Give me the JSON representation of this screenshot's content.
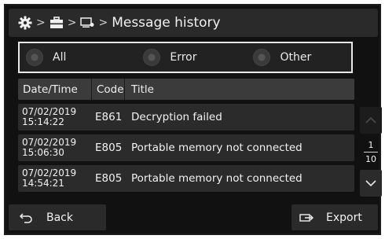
{
  "header": {
    "breadcrumb": [
      {
        "icon": "gear-icon"
      },
      {
        "icon": "toolbox-icon"
      },
      {
        "icon": "device-icon"
      }
    ],
    "title": "Message history"
  },
  "filters": {
    "options": [
      "All",
      "Error",
      "Other"
    ]
  },
  "table": {
    "columns": [
      "Date/Time",
      "Code",
      "Title"
    ],
    "rows": [
      {
        "date": "07/02/2019",
        "time": "15:14:22",
        "code": "E861",
        "title": "Decryption failed"
      },
      {
        "date": "07/02/2019",
        "time": "15:06:30",
        "code": "E805",
        "title": "Portable memory not connected"
      },
      {
        "date": "07/02/2019",
        "time": "14:54:21",
        "code": "E805",
        "title": "Portable memory not connected"
      }
    ]
  },
  "pager": {
    "current": "1",
    "total": "10"
  },
  "footer": {
    "back_label": "Back",
    "export_label": "Export"
  }
}
